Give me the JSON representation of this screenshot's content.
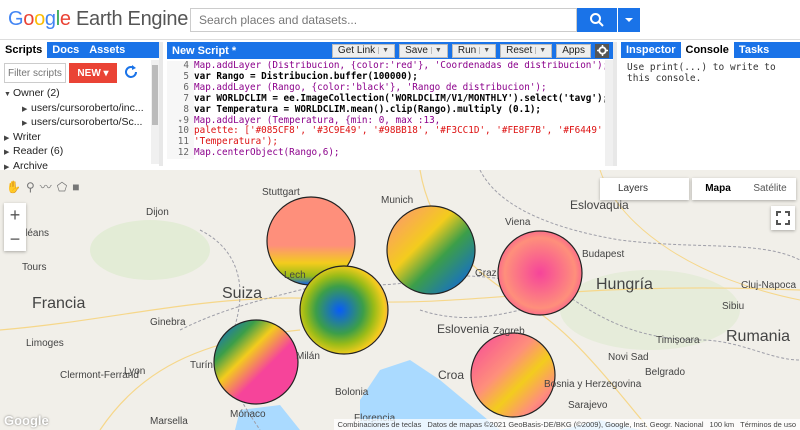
{
  "header": {
    "logo_letters": [
      "G",
      "o",
      "o",
      "g",
      "l",
      "e"
    ],
    "logo_rest": " Earth Engine",
    "search_placeholder": "Search places and datasets..."
  },
  "left_panel": {
    "tabs": [
      "Scripts",
      "Docs",
      "Assets"
    ],
    "filter_placeholder": "Filter scripts",
    "new_label": "NEW",
    "tree": [
      {
        "label": "Owner (2)",
        "level": 0,
        "expanded": true
      },
      {
        "label": "users/cursoroberto/inc...",
        "level": 1,
        "expanded": false
      },
      {
        "label": "users/cursoroberto/Sc...",
        "level": 1,
        "expanded": false
      },
      {
        "label": "Writer",
        "level": 0,
        "expanded": false
      },
      {
        "label": "Reader (6)",
        "level": 0,
        "expanded": false
      },
      {
        "label": "Archive",
        "level": 0,
        "expanded": false
      }
    ]
  },
  "center_panel": {
    "title": "New Script *",
    "buttons": {
      "get_link": "Get Link",
      "save": "Save",
      "run": "Run",
      "reset": "Reset",
      "apps": "Apps"
    },
    "line_numbers": [
      "4",
      "5",
      "6",
      "7",
      "8",
      "9",
      "10",
      "11",
      "12"
    ],
    "code_lines": [
      "Map.addLayer (Distribucion, {color:'red'}, 'Coordenadas de distribucion');",
      "var Rango = Distribucion.buffer(100000);",
      "Map.addLayer (Rango, {color:'black'}, 'Rango de distribucion');",
      "var WORLDCLIM = ee.ImageCollection('WORLDCLIM/V1/MONTHLY').select('tavg');",
      "var Temperatura = WORLDCLIM.mean().clip(Rango).multiply (0.1);",
      "Map.addLayer (Temperatura, {min: 0, max :13,",
      "palette: ['#085CF8', '#3C9E49', '#98BB18', '#F3CC1D', '#FE8F7B', '#F6449'",
      "'Temperatura');",
      "Map.centerObject(Rango,6);"
    ]
  },
  "right_panel": {
    "tabs": [
      "Inspector",
      "Console",
      "Tasks"
    ],
    "console_text": "Use print(...) to write to this console."
  },
  "map": {
    "layers_label": "Layers",
    "map_type": [
      "Mapa",
      "Satélite"
    ],
    "cities": [
      {
        "name": "Stuttgart"
      },
      {
        "name": "Munich"
      },
      {
        "name": "Viena"
      },
      {
        "name": "Eslovaquia"
      },
      {
        "name": "Budapest"
      },
      {
        "name": "Hungría"
      },
      {
        "name": "Graz"
      },
      {
        "name": "Suiza"
      },
      {
        "name": "Ginebra"
      },
      {
        "name": "Lech"
      },
      {
        "name": "Eslovenia"
      },
      {
        "name": "Zagreb"
      },
      {
        "name": "Cluj-Napoca"
      },
      {
        "name": "Timișoara"
      },
      {
        "name": "Rumania"
      },
      {
        "name": "Novi Sad"
      },
      {
        "name": "Belgrado"
      },
      {
        "name": "Bolonia"
      },
      {
        "name": "Croa"
      },
      {
        "name": "Francia"
      },
      {
        "name": "Lyon"
      },
      {
        "name": "Dijon"
      },
      {
        "name": "Mónaco"
      },
      {
        "name": "Sarajevo"
      },
      {
        "name": "Bosnia y Herzegovina"
      },
      {
        "name": "Sibiu"
      },
      {
        "name": "Orléans"
      },
      {
        "name": "Marsella"
      },
      {
        "name": "Florencia"
      },
      {
        "name": "Turín"
      },
      {
        "name": "Milán"
      },
      {
        "name": "Tours"
      },
      {
        "name": "Limoges"
      },
      {
        "name": "Clermont-Ferrand"
      }
    ],
    "attribution": [
      "Combinaciones de teclas",
      "Datos de mapas ©2021 GeoBasis-DE/BKG (©2009), Google, Inst. Geogr. Nacional",
      "100 km",
      "Términos de uso"
    ],
    "google_mark": "Google",
    "colors": {
      "blue": "#085CF8",
      "green": "#3C9E49",
      "yellowgreen": "#98BB18",
      "yellow": "#F3CC1D",
      "salmon": "#FE8F7B",
      "pink": "#F6449A"
    }
  }
}
